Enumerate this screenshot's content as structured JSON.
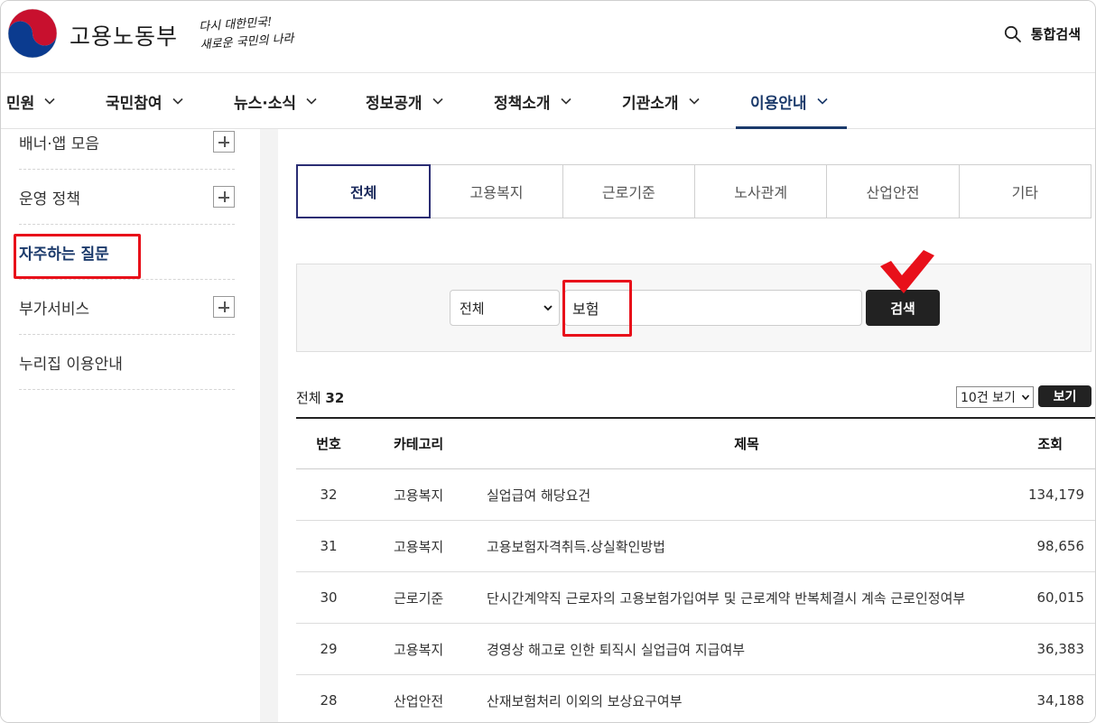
{
  "header": {
    "logo_text": "고용노동부",
    "slogan_line1": "다시 대한민국!",
    "slogan_line2": "새로운 국민의 나라",
    "search_label": "통합검색"
  },
  "gnb": {
    "items": [
      {
        "label": "민원"
      },
      {
        "label": "국민참여"
      },
      {
        "label": "뉴스·소식"
      },
      {
        "label": "정보공개"
      },
      {
        "label": "정책소개"
      },
      {
        "label": "기관소개"
      },
      {
        "label": "이용안내"
      }
    ],
    "active_index": 6
  },
  "sidebar": {
    "items": [
      {
        "label": "배너·앱 모음",
        "expandable": true
      },
      {
        "label": "운영 정책",
        "expandable": true
      },
      {
        "label": "자주하는 질문",
        "expandable": false
      },
      {
        "label": "부가서비스",
        "expandable": true
      },
      {
        "label": "누리집 이용안내",
        "expandable": false
      }
    ],
    "active_index": 2
  },
  "tabs": {
    "items": [
      "전체",
      "고용복지",
      "근로기준",
      "노사관계",
      "산업안전",
      "기타"
    ],
    "active_index": 0
  },
  "search": {
    "select_value": "전체",
    "input_value": "보험",
    "button_label": "검색"
  },
  "results": {
    "total_label": "전체",
    "total_count": "32",
    "per_page_value": "10건 보기",
    "view_button": "보기"
  },
  "table": {
    "headers": {
      "num": "번호",
      "category": "카테고리",
      "title": "제목",
      "views": "조회"
    },
    "rows": [
      {
        "num": "32",
        "category": "고용복지",
        "title": "실업급여 해당요건",
        "views": "134,179"
      },
      {
        "num": "31",
        "category": "고용복지",
        "title": "고용보험자격취득.상실확인방법",
        "views": "98,656"
      },
      {
        "num": "30",
        "category": "근로기준",
        "title": "단시간계약직 근로자의 고용보험가입여부 및 근로계약 반복체결시 계속 근로인정여부",
        "views": "60,015"
      },
      {
        "num": "29",
        "category": "고용복지",
        "title": "경영상 해고로 인한 퇴직시 실업급여 지급여부",
        "views": "36,383"
      },
      {
        "num": "28",
        "category": "산업안전",
        "title": "산재보험처리 이외의 보상요구여부",
        "views": "34,188"
      }
    ]
  },
  "colors": {
    "brand_navy": "#1b3a6b",
    "highlight_red": "#e8101a",
    "button_dark": "#222222"
  }
}
